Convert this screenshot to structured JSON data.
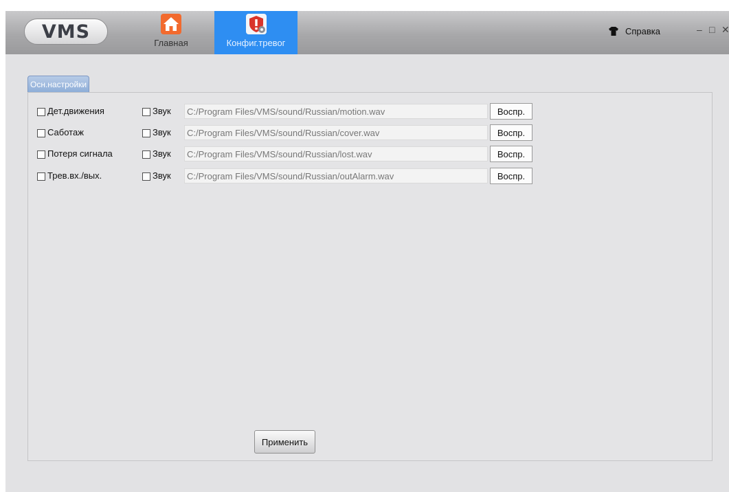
{
  "app": {
    "logo": "VMS"
  },
  "nav": {
    "items": [
      {
        "label": "Главная",
        "icon": "home-icon",
        "color": "#f26a2e",
        "active": false
      },
      {
        "label": "Конфиг.тревог",
        "icon": "alarm-shield-icon",
        "color": "#d9342b",
        "active": true
      }
    ],
    "active_color": "#2e8ef2"
  },
  "header": {
    "help_label": "Справка",
    "help_icon": "shirt-icon"
  },
  "window_controls": {
    "minimize": "–",
    "maximize": "□",
    "close": "✕"
  },
  "tabs": [
    {
      "label": "Осн.настройки",
      "active": true
    }
  ],
  "alarms": [
    {
      "label": "Дет.движения",
      "checked": false,
      "sound_label": "Звук",
      "sound_checked": false,
      "path": "C:/Program Files/VMS/sound/Russian/motion.wav",
      "play_label": "Воспр."
    },
    {
      "label": "Саботаж",
      "checked": false,
      "sound_label": "Звук",
      "sound_checked": false,
      "path": "C:/Program Files/VMS/sound/Russian/cover.wav",
      "play_label": "Воспр."
    },
    {
      "label": "Потеря сигнала",
      "checked": false,
      "sound_label": "Звук",
      "sound_checked": false,
      "path": "C:/Program Files/VMS/sound/Russian/lost.wav",
      "play_label": "Воспр."
    },
    {
      "label": "Трев.вх./вых.",
      "checked": false,
      "sound_label": "Звук",
      "sound_checked": false,
      "path": "C:/Program Files/VMS/sound/Russian/outAlarm.wav",
      "play_label": "Воспр."
    }
  ],
  "footer": {
    "apply_label": "Применить"
  }
}
